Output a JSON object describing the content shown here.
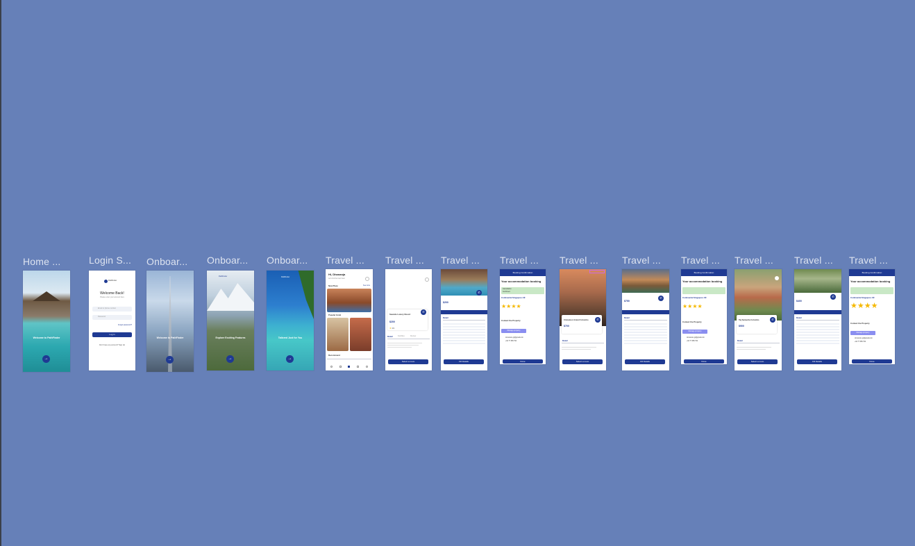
{
  "canvas": {
    "background": "#6680b8",
    "frames": [
      {
        "id": "f1",
        "label": "Home ..."
      },
      {
        "id": "f2",
        "label": "Login S..."
      },
      {
        "id": "f3",
        "label": "Onboar..."
      },
      {
        "id": "f4",
        "label": "Onboar..."
      },
      {
        "id": "f5",
        "label": "Onboar..."
      },
      {
        "id": "f6",
        "label": "Travel ..."
      },
      {
        "id": "f7",
        "label": "Travel ..."
      },
      {
        "id": "f8",
        "label": "Travel ..."
      },
      {
        "id": "f9",
        "label": "Travel ..."
      },
      {
        "id": "f10",
        "label": "Travel ..."
      },
      {
        "id": "f11",
        "label": "Travel ..."
      },
      {
        "id": "f12",
        "label": "Travel ..."
      },
      {
        "id": "f13",
        "label": "Travel ..."
      },
      {
        "id": "f14",
        "label": "Travel ..."
      },
      {
        "id": "f15",
        "label": "Travel ..."
      }
    ]
  },
  "home": {
    "headline": "Welcome to PathFinder"
  },
  "login": {
    "logo": "PathFinder",
    "title": "Welcome Back!",
    "subtitle": "Please enter your account here",
    "email_placeholder": "Email or phone number",
    "password_placeholder": "Password",
    "forgot": "Forgot password?",
    "login_button": "Log in",
    "signup_prompt": "Don't have any account? Sign Up"
  },
  "onboarding": {
    "o1": "Welcome to PathFinder",
    "o2": "Explore Exciting Features",
    "o3": "Tailored Just for You",
    "logo": "PathFinder"
  },
  "explore": {
    "greeting": "Hi, Dhananja",
    "sub": "Let's find the best hotel",
    "new_label": "New Place",
    "popular_label": "Popular Hotel",
    "recommend_label": "Recommend",
    "see_all": "See more"
  },
  "detail": {
    "hotel1": "Seaside Luxury Resort",
    "price1": "$200",
    "rating1": "4.9",
    "tab_detail": "Detail",
    "tab_facilities": "Facilities",
    "tab_review": "Review",
    "select_room": "Select a room",
    "fill_details": "Fill Details",
    "hotel_gs": "Cinnamon Grand Colombo",
    "price_gs": "$700",
    "price_gs2": "$750",
    "hotel_taj": "Taj Samudra Colombo",
    "price_taj": "$900",
    "price_f15": "$400"
  },
  "confirm": {
    "header": "Booking Confirmation",
    "title": "Your accommodation booking",
    "hotel": "Continental Singapore 4★",
    "contact": "Contact the Property",
    "manage": "Manage property",
    "email": "cinnamon.gc@gmail.com",
    "phone": "+94 77 658 794",
    "done": "Done",
    "cancellation": "Cancellation",
    "status": "Confirmed"
  },
  "colors": {
    "navy": "#1f3a93",
    "accent": "#f5b800",
    "canvas": "#6680b8"
  }
}
